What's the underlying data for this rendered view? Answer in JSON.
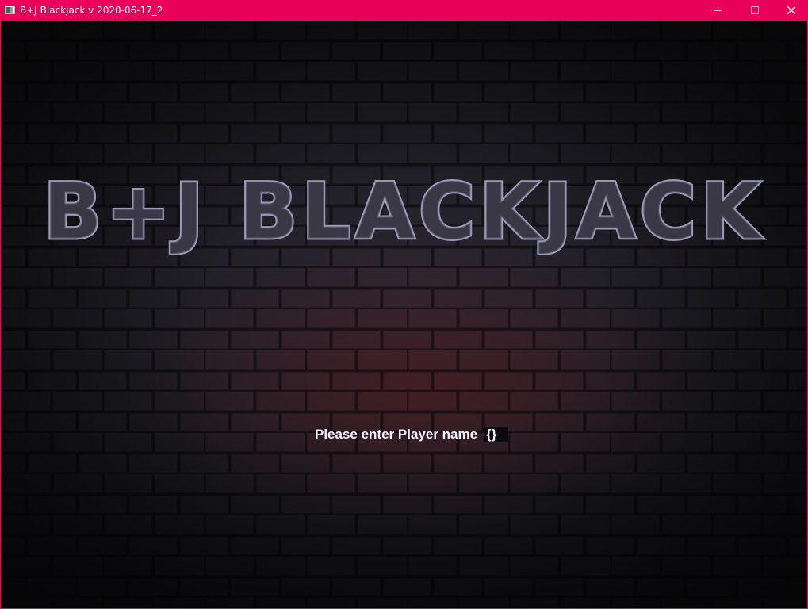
{
  "window": {
    "title": "B+J Blackjack v 2020-06-17_2",
    "accent_color": "#e8005a",
    "controls": {
      "minimize_icon": "minimize-icon",
      "maximize_icon": "maximize-icon",
      "close_icon": "close-icon"
    }
  },
  "game": {
    "logo_text": "B+J BLACKJACK",
    "prompt_label": "Please enter Player name",
    "name_input_value": "{}"
  }
}
